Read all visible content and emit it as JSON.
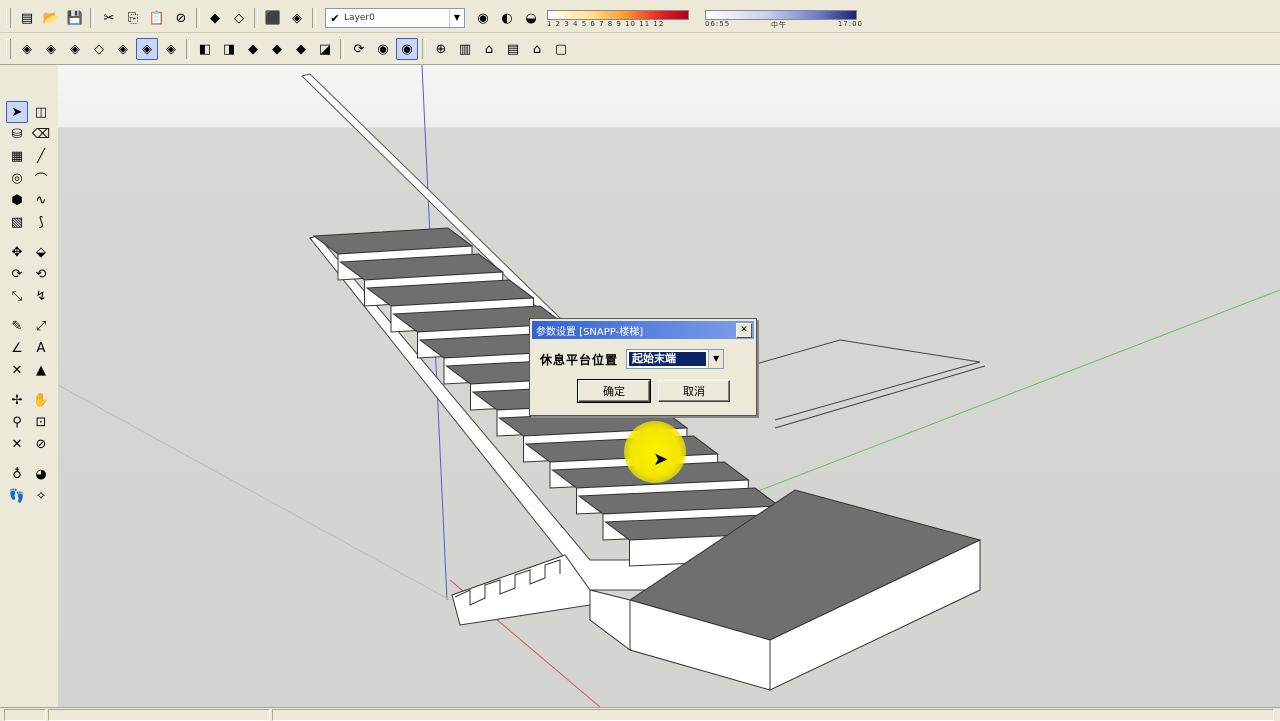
{
  "toolbar1": {
    "buttons": [
      {
        "name": "new-icon",
        "glyph": "▤"
      },
      {
        "name": "open-icon",
        "glyph": "📂"
      },
      {
        "name": "save-icon",
        "glyph": "💾"
      },
      {
        "name": "cut-icon",
        "glyph": "✂"
      },
      {
        "name": "copy-icon",
        "glyph": "⎘"
      },
      {
        "name": "paste-icon",
        "glyph": "📋"
      },
      {
        "name": "erase-icon",
        "glyph": "⊘"
      },
      {
        "name": "undo-icon",
        "glyph": "◆"
      },
      {
        "name": "redo-icon",
        "glyph": "◇"
      },
      {
        "name": "component-icon",
        "glyph": "⬛"
      },
      {
        "name": "share-model-icon",
        "glyph": "◈"
      }
    ],
    "layer": {
      "checked": "✔",
      "name": "Layer0"
    },
    "extra_buttons": [
      {
        "name": "layer-manager-icon",
        "glyph": "◉"
      },
      {
        "name": "shadow-toggle-icon",
        "glyph": "◐"
      },
      {
        "name": "fog-toggle-icon",
        "glyph": "◒"
      }
    ],
    "month_ticks": "1 2 3 4 5 6 7 8 9 10 11 12",
    "time_start": "06:55",
    "time_mid": "中午",
    "time_end": "17:00"
  },
  "toolbar2": {
    "buttons": [
      {
        "name": "iso-view-icon",
        "glyph": "◈"
      },
      {
        "name": "top-view-icon",
        "glyph": "◈"
      },
      {
        "name": "front-view-icon",
        "glyph": "◈"
      },
      {
        "name": "right-view-icon",
        "glyph": "◇"
      },
      {
        "name": "back-view-icon",
        "glyph": "◈"
      },
      {
        "name": "left-view-icon",
        "glyph": "◈",
        "active": true
      },
      {
        "name": "bottom-view-icon",
        "glyph": "◈"
      },
      {
        "name": "xray-icon",
        "glyph": "◧"
      },
      {
        "name": "wireframe-icon",
        "glyph": "◨"
      },
      {
        "name": "hidden-line-icon",
        "glyph": "◆"
      },
      {
        "name": "shaded-icon",
        "glyph": "◆"
      },
      {
        "name": "shaded-texture-icon",
        "glyph": "◆"
      },
      {
        "name": "monochrome-icon",
        "glyph": "◪"
      },
      {
        "name": "orbit-icon",
        "glyph": "⟳"
      },
      {
        "name": "pan-icon",
        "glyph": "◉"
      },
      {
        "name": "zoom-extents-icon",
        "glyph": "◉",
        "active": true
      },
      {
        "name": "warehouse-icon",
        "glyph": "⊕"
      },
      {
        "name": "section-icon",
        "glyph": "▥"
      },
      {
        "name": "house-icon",
        "glyph": "⌂"
      },
      {
        "name": "building-icon",
        "glyph": "▤"
      },
      {
        "name": "roof-icon",
        "glyph": "⌂"
      },
      {
        "name": "box-icon",
        "glyph": "▢"
      }
    ]
  },
  "left_tools": [
    {
      "name": "select-tool-icon",
      "glyph": "➤",
      "active": true
    },
    {
      "name": "make-component-icon",
      "glyph": "◫"
    },
    {
      "name": "paint-bucket-icon",
      "glyph": "⛁"
    },
    {
      "name": "eraser-icon",
      "glyph": "⌫"
    },
    {
      "name": "rectangle-tool-icon",
      "glyph": "▦"
    },
    {
      "name": "line-tool-icon",
      "glyph": "╱"
    },
    {
      "name": "circle-tool-icon",
      "glyph": "◎"
    },
    {
      "name": "arc-tool-icon",
      "glyph": "⌒"
    },
    {
      "name": "polygon-tool-icon",
      "glyph": "⬢"
    },
    {
      "name": "freehand-tool-icon",
      "glyph": "∿"
    },
    {
      "name": "offset-tool-icon",
      "glyph": "▧"
    },
    {
      "name": "curve-tool-icon",
      "glyph": "⟆"
    },
    {
      "gap": true
    },
    {
      "name": "move-tool-icon",
      "glyph": "✥"
    },
    {
      "name": "push-pull-icon",
      "glyph": "⬙"
    },
    {
      "name": "rotate-tool-icon",
      "glyph": "⟳"
    },
    {
      "name": "follow-me-icon",
      "glyph": "⟲"
    },
    {
      "name": "scale-tool-icon",
      "glyph": "⤡"
    },
    {
      "name": "offset-edge-icon",
      "glyph": "↯"
    },
    {
      "gap": true
    },
    {
      "name": "tape-measure-icon",
      "glyph": "✎"
    },
    {
      "name": "dimension-icon",
      "glyph": "⤢"
    },
    {
      "name": "protractor-icon",
      "glyph": "∠"
    },
    {
      "name": "text-tool-icon",
      "glyph": "A"
    },
    {
      "name": "axes-tool-icon",
      "glyph": "✕"
    },
    {
      "name": "3d-text-icon",
      "glyph": "▲"
    },
    {
      "gap": true
    },
    {
      "name": "orbit-tool-icon",
      "glyph": "✢"
    },
    {
      "name": "pan-tool-icon",
      "glyph": "✋"
    },
    {
      "name": "zoom-tool-icon",
      "glyph": "⚲"
    },
    {
      "name": "zoom-window-icon",
      "glyph": "⊡"
    },
    {
      "name": "zoom-extents-tool-icon",
      "glyph": "✕"
    },
    {
      "name": "previous-view-icon",
      "glyph": "⊘"
    },
    {
      "gap": true
    },
    {
      "name": "position-camera-icon",
      "glyph": "♁"
    },
    {
      "name": "look-around-icon",
      "glyph": "◕"
    },
    {
      "name": "walk-icon",
      "glyph": "👣"
    },
    {
      "name": "section-plane-icon",
      "glyph": "✧"
    }
  ],
  "dialog": {
    "title": "参数设置 [SNAPP-楼梯]",
    "field_label": "休息平台位置",
    "field_value": "起始末端",
    "ok_label": "确定",
    "cancel_label": "取消"
  },
  "colors": {
    "toolbar_bg": "#ece9d8",
    "viewport_ground": "#d3d3cf",
    "selection_blue": "#0a246a",
    "highlight_yellow": "#fff100"
  }
}
